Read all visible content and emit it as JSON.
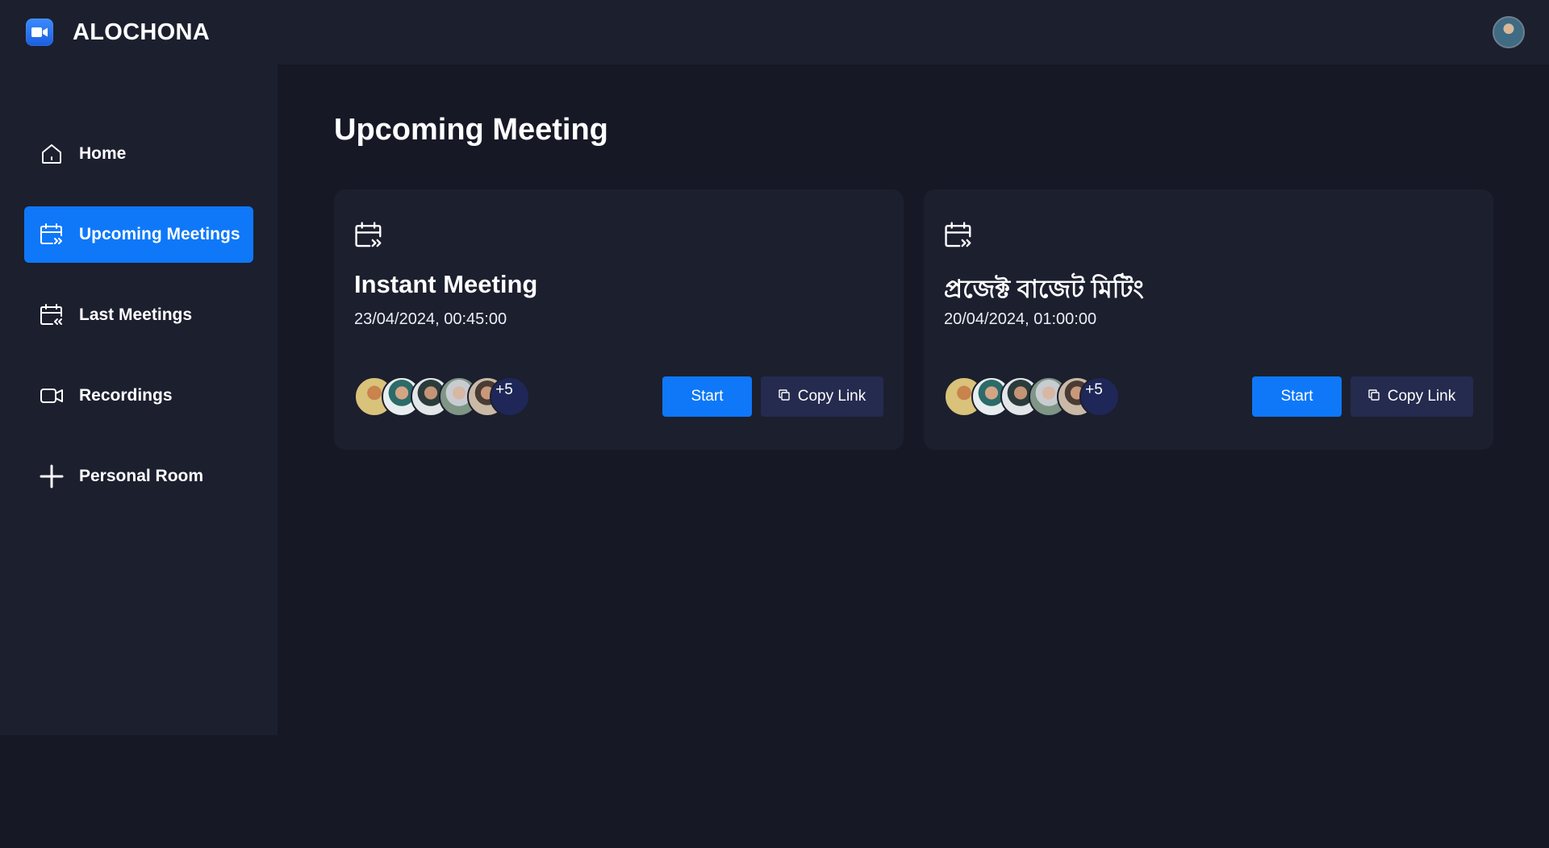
{
  "app": {
    "name": "ALOCHONA",
    "logo_icon": "video-camera-icon",
    "accent_color": "#0e78f9"
  },
  "header": {
    "profile_icon": "user-avatar"
  },
  "sidebar": {
    "items": [
      {
        "label": "Home",
        "icon": "home-icon",
        "active": false
      },
      {
        "label": "Upcoming Meetings",
        "icon": "calendar-forward-icon",
        "active": true
      },
      {
        "label": "Last Meetings",
        "icon": "calendar-back-icon",
        "active": false
      },
      {
        "label": "Recordings",
        "icon": "video-icon",
        "active": false
      },
      {
        "label": "Personal Room",
        "icon": "plus-icon",
        "active": false
      }
    ]
  },
  "main": {
    "title": "Upcoming Meeting",
    "meetings": [
      {
        "title": "Instant Meeting",
        "datetime": "23/04/2024, 00:45:00",
        "more_attendees": "+5",
        "start_label": "Start",
        "copy_label": "Copy Link"
      },
      {
        "title": "প্রজেক্ট বাজেট মিটিং",
        "datetime": "20/04/2024, 01:00:00",
        "more_attendees": "+5",
        "start_label": "Start",
        "copy_label": "Copy Link"
      }
    ]
  }
}
